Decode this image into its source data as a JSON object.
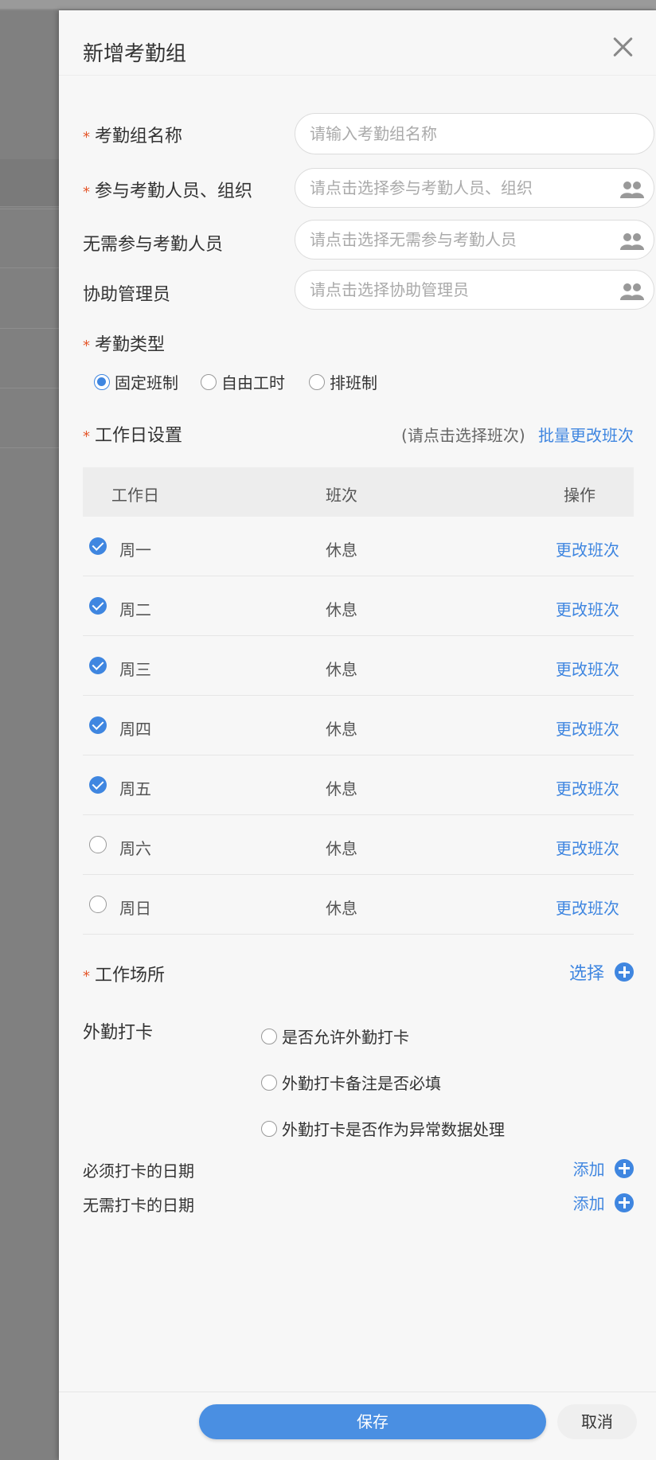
{
  "drawer": {
    "title": "新增考勤组"
  },
  "form": {
    "group_name": {
      "label": "考勤组名称",
      "placeholder": "请输入考勤组名称",
      "required": true
    },
    "participants": {
      "label": "参与考勤人员、组织",
      "placeholder": "请点击选择参与考勤人员、组织",
      "required": true
    },
    "excluded": {
      "label": "无需参与考勤人员",
      "placeholder": "请点击选择无需参与考勤人员"
    },
    "assist_admin": {
      "label": "协助管理员",
      "placeholder": "请点击选择协助管理员"
    },
    "type": {
      "label": "考勤类型",
      "options": [
        "固定班制",
        "自由工时",
        "排班制"
      ],
      "selected": "固定班制"
    },
    "workday": {
      "label": "工作日设置",
      "hint": "(请点击选择班次)",
      "batch_link": "批量更改班次"
    }
  },
  "table": {
    "headers": [
      "工作日",
      "班次",
      "操作"
    ],
    "rows": [
      {
        "day": "周一",
        "shift": "休息",
        "action": "更改班次",
        "checked": true
      },
      {
        "day": "周二",
        "shift": "休息",
        "action": "更改班次",
        "checked": true
      },
      {
        "day": "周三",
        "shift": "休息",
        "action": "更改班次",
        "checked": true
      },
      {
        "day": "周四",
        "shift": "休息",
        "action": "更改班次",
        "checked": true
      },
      {
        "day": "周五",
        "shift": "休息",
        "action": "更改班次",
        "checked": true
      },
      {
        "day": "周六",
        "shift": "休息",
        "action": "更改班次",
        "checked": false
      },
      {
        "day": "周日",
        "shift": "休息",
        "action": "更改班次",
        "checked": false
      }
    ]
  },
  "workplace": {
    "label": "工作场所",
    "action": "选择"
  },
  "field_checkin": {
    "label": "外勤打卡",
    "options": [
      "是否允许外勤打卡",
      "外勤打卡备注是否必填",
      "外勤打卡是否作为异常数据处理"
    ]
  },
  "must_dates": {
    "label": "必须打卡的日期",
    "action": "添加"
  },
  "no_need_dates": {
    "label": "无需打卡的日期",
    "action": "添加"
  },
  "footer": {
    "save": "保存",
    "cancel": "取消"
  },
  "colors": {
    "accent": "#3f86e0",
    "required": "#e5572b",
    "save_button": "#4a8fe2"
  },
  "icons": {
    "close": "close-icon",
    "people": "people-icon",
    "plus": "plus-circle-icon"
  }
}
